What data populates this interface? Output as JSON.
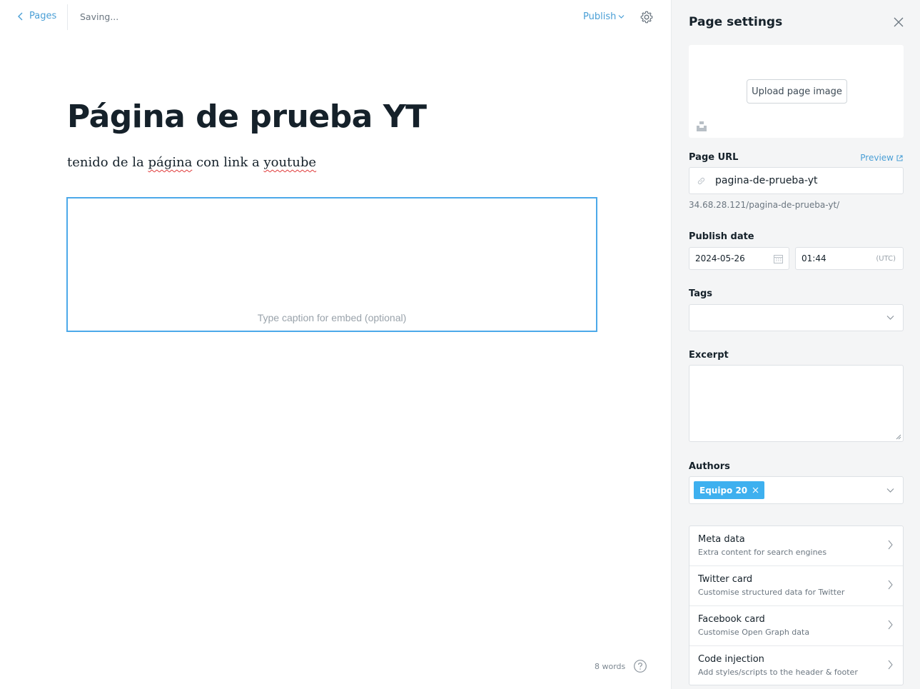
{
  "editor": {
    "back_label": "Pages",
    "status": "Saving...",
    "publish_label": "Publish",
    "title": "Página de prueba YT",
    "body": {
      "part1": "tenido de la ",
      "word1": "página",
      "part2": " con link a ",
      "word2": "youtube"
    },
    "embed_caption_placeholder": "Type caption for embed (optional)",
    "word_count": "8 words"
  },
  "settings": {
    "title": "Page settings",
    "upload_label": "Upload page image",
    "url_label": "Page URL",
    "preview_label": "Preview",
    "slug": "pagina-de-prueba-yt",
    "url_hint": "34.68.28.121/pagina-de-prueba-yt/",
    "publish_date_label": "Publish date",
    "date": "2024-05-26",
    "time": "01:44",
    "timezone": "(UTC)",
    "tags_label": "Tags",
    "excerpt_label": "Excerpt",
    "authors_label": "Authors",
    "author": "Equipo 20",
    "menu": [
      {
        "title": "Meta data",
        "subtitle": "Extra content for search engines"
      },
      {
        "title": "Twitter card",
        "subtitle": "Customise structured data for Twitter"
      },
      {
        "title": "Facebook card",
        "subtitle": "Customise Open Graph data"
      },
      {
        "title": "Code injection",
        "subtitle": "Add styles/scripts to the header & footer"
      }
    ]
  },
  "colors": {
    "accent": "#4a9fd6",
    "tag": "#3eb0ef",
    "embed_border": "#4ca9e9",
    "panel_bg": "#f4f5f6"
  }
}
